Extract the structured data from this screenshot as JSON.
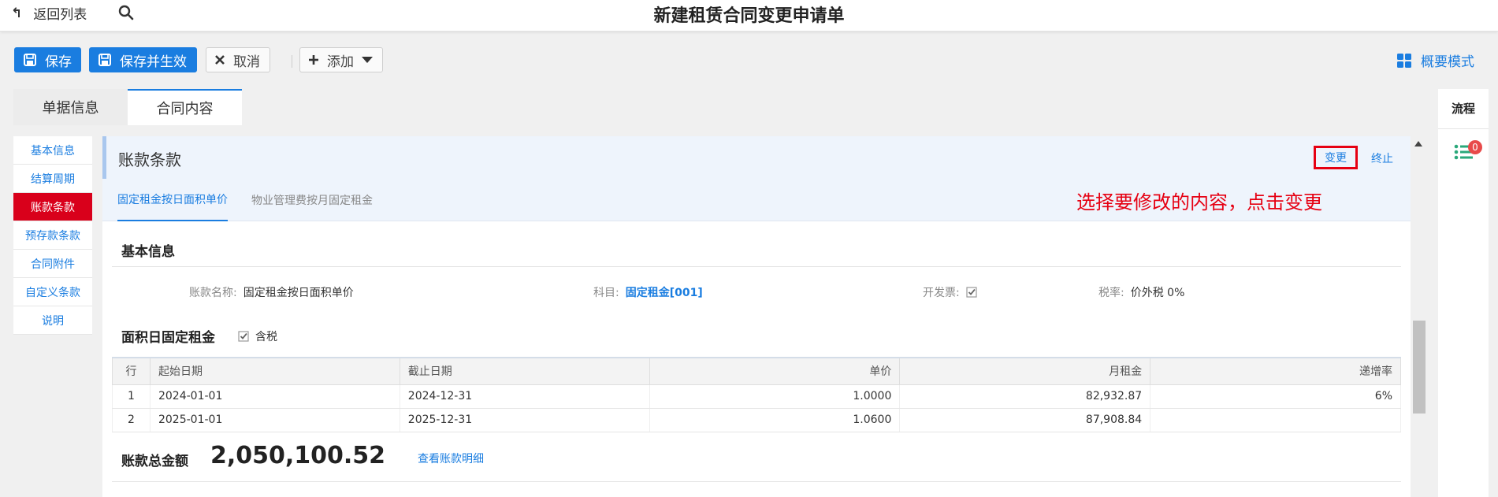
{
  "header": {
    "back_label": "返回列表",
    "title": "新建租赁合同变更申请单"
  },
  "toolbar": {
    "save_label": "保存",
    "save_effective_label": "保存并生效",
    "cancel_label": "取消",
    "add_label": "添加",
    "overview_label": "概要模式",
    "accent_color": "#1a7de0"
  },
  "tabs": [
    {
      "label": "单据信息",
      "active": false
    },
    {
      "label": "合同内容",
      "active": true
    }
  ],
  "sidebar": {
    "items": [
      {
        "label": "基本信息"
      },
      {
        "label": "结算周期"
      },
      {
        "label": "账款条款",
        "active": true
      },
      {
        "label": "预存款条款"
      },
      {
        "label": "合同附件"
      },
      {
        "label": "自定义条款"
      },
      {
        "label": "说明"
      }
    ]
  },
  "section": {
    "title": "账款条款",
    "change_label": "变更",
    "end_label": "终止",
    "annotation": "选择要修改的内容，点击变更",
    "subtabs": [
      {
        "label": "固定租金按日面积单价",
        "active": true
      },
      {
        "label": "物业管理费按月固定租金",
        "active": false
      }
    ]
  },
  "basic": {
    "title": "基本信息",
    "account_name_label": "账款名称:",
    "account_name_value": "固定租金按日面积单价",
    "subject_label": "科目:",
    "subject_value": "固定租金[001]",
    "invoice_label": "开发票:",
    "invoice_checked": true,
    "tax_rate_label": "税率:",
    "tax_rate_value": "价外税 0%"
  },
  "rent": {
    "title": "面积日固定租金",
    "tax_included_label": "含税",
    "tax_included_checked": true,
    "columns": [
      "行",
      "起始日期",
      "截止日期",
      "单价",
      "月租金",
      "递增率"
    ],
    "rows": [
      {
        "row": "1",
        "start": "2024-01-01",
        "end": "2024-12-31",
        "price": "1.0000",
        "monthly": "82,932.87",
        "rate": "6%"
      },
      {
        "row": "2",
        "start": "2025-01-01",
        "end": "2025-12-31",
        "price": "1.0600",
        "monthly": "87,908.84",
        "rate": ""
      }
    ]
  },
  "total": {
    "label": "账款总金额",
    "value": "2,050,100.52",
    "detail_link": "查看账款明细"
  },
  "right_panel": {
    "flow_label": "流程",
    "badge_count": "0"
  }
}
